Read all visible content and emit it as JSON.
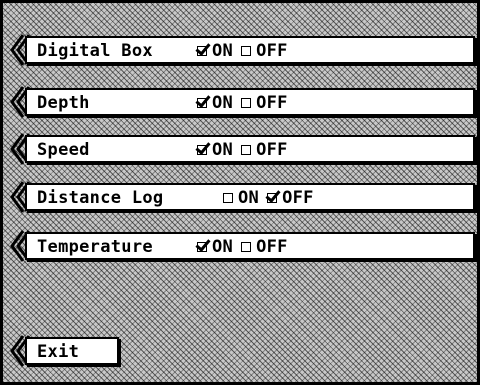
{
  "settings": [
    {
      "label": "Digital Box",
      "on_label": "ON",
      "off_label": "OFF",
      "on_checked": true,
      "off_checked": false
    },
    {
      "label": "Depth",
      "on_label": "ON",
      "off_label": "OFF",
      "on_checked": true,
      "off_checked": false
    },
    {
      "label": "Speed",
      "on_label": "ON",
      "off_label": "OFF",
      "on_checked": true,
      "off_checked": false
    },
    {
      "label": "Distance Log",
      "on_label": "ON",
      "off_label": "OFF",
      "on_checked": false,
      "off_checked": true
    },
    {
      "label": "Temperature",
      "on_label": "ON",
      "off_label": "OFF",
      "on_checked": true,
      "off_checked": false
    }
  ],
  "exit": {
    "label": "Exit"
  },
  "icons": {
    "arrow": "chevron-left-icon",
    "checkbox": "checkbox-icon"
  }
}
